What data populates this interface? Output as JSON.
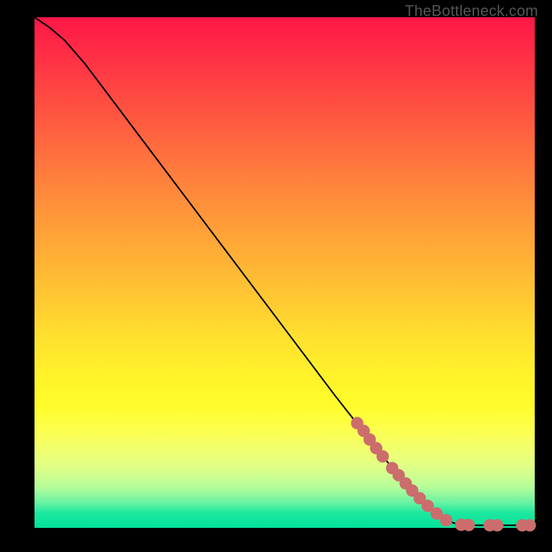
{
  "watermark": "TheBottleneck.com",
  "chart_data": {
    "type": "line",
    "xlim": [
      0,
      100
    ],
    "ylim": [
      0,
      100
    ],
    "grid": false,
    "legend": false,
    "xlabel": "",
    "ylabel": "",
    "curve": [
      {
        "x": 0,
        "y": 100
      },
      {
        "x": 3,
        "y": 98
      },
      {
        "x": 6,
        "y": 95.5
      },
      {
        "x": 10,
        "y": 91
      },
      {
        "x": 15,
        "y": 84.5
      },
      {
        "x": 20,
        "y": 78
      },
      {
        "x": 30,
        "y": 65
      },
      {
        "x": 40,
        "y": 52
      },
      {
        "x": 50,
        "y": 39
      },
      {
        "x": 60,
        "y": 26
      },
      {
        "x": 66,
        "y": 18.5
      },
      {
        "x": 70,
        "y": 13.5
      },
      {
        "x": 75,
        "y": 8
      },
      {
        "x": 80,
        "y": 3.2
      },
      {
        "x": 83,
        "y": 1.2
      },
      {
        "x": 85,
        "y": 0.6
      },
      {
        "x": 88,
        "y": 0.5
      },
      {
        "x": 92,
        "y": 0.5
      },
      {
        "x": 96,
        "y": 0.5
      },
      {
        "x": 100,
        "y": 0.5
      }
    ],
    "points": [
      {
        "x": 64.5,
        "y": 20.5
      },
      {
        "x": 65.8,
        "y": 19
      },
      {
        "x": 67.0,
        "y": 17.3
      },
      {
        "x": 68.3,
        "y": 15.6
      },
      {
        "x": 69.6,
        "y": 14
      },
      {
        "x": 71.5,
        "y": 11.7
      },
      {
        "x": 72.8,
        "y": 10.3
      },
      {
        "x": 74.2,
        "y": 8.7
      },
      {
        "x": 75.5,
        "y": 7.3
      },
      {
        "x": 77.0,
        "y": 5.8
      },
      {
        "x": 78.6,
        "y": 4.3
      },
      {
        "x": 80.4,
        "y": 2.8
      },
      {
        "x": 82.3,
        "y": 1.5
      },
      {
        "x": 85.3,
        "y": 0.6
      },
      {
        "x": 86.8,
        "y": 0.55
      },
      {
        "x": 91.0,
        "y": 0.5
      },
      {
        "x": 92.5,
        "y": 0.5
      },
      {
        "x": 97.5,
        "y": 0.5
      },
      {
        "x": 99.0,
        "y": 0.5
      }
    ],
    "point_color": "#cc6d6d",
    "point_radius": 9
  }
}
